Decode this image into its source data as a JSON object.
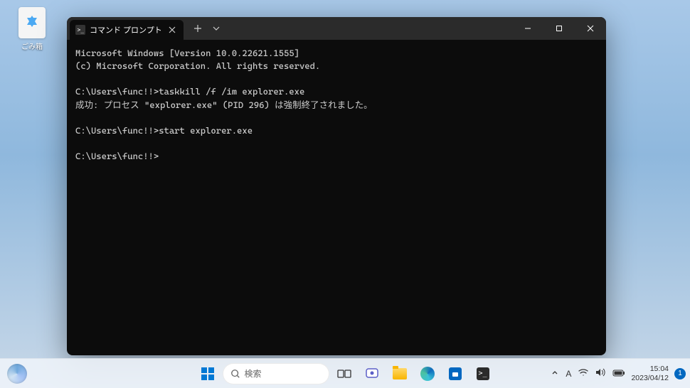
{
  "desktop": {
    "recycle_bin_label": "ごみ箱"
  },
  "window": {
    "tab_title": "コマンド プロンプト"
  },
  "terminal": {
    "lines": [
      "Microsoft Windows [Version 10.0.22621.1555]",
      "(c) Microsoft Corporation. All rights reserved.",
      "",
      "C:\\Users\\func!!>taskkill /f /im explorer.exe",
      "成功: プロセス \"explorer.exe\" (PID 296) は強制終了されました。",
      "",
      "C:\\Users\\func!!>start explorer.exe",
      "",
      "C:\\Users\\func!!>"
    ]
  },
  "taskbar": {
    "search_placeholder": "検索",
    "ime_indicator": "A",
    "time": "15:04",
    "date": "2023/04/12",
    "notification_count": "1"
  }
}
